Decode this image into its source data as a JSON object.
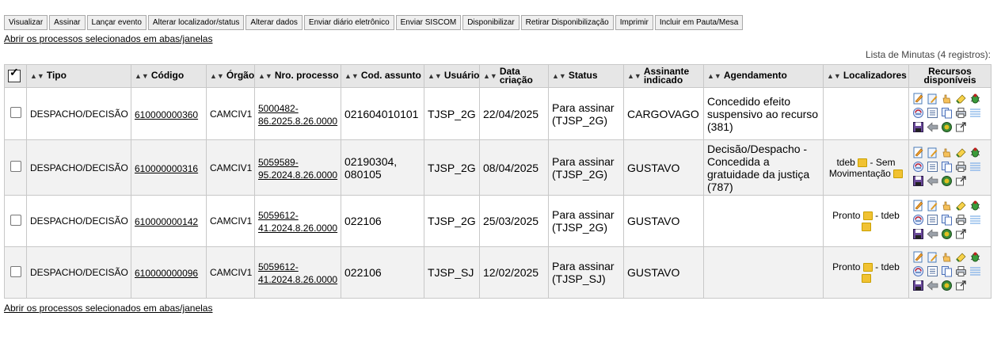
{
  "toolbar": {
    "buttons": [
      "Visualizar",
      "Assinar",
      "Lançar evento",
      "Alterar localizador/status",
      "Alterar dados",
      "Enviar diário eletrônico",
      "Enviar SISCOM",
      "Disponibilizar",
      "Retirar Disponibilização",
      "Imprimir",
      "Incluir em Pauta/Mesa"
    ]
  },
  "links": {
    "open_top": "Abrir os processos selecionados em abas/janelas",
    "open_bottom": "Abrir os processos selecionados em abas/janelas"
  },
  "list_count": "Lista de Minutas (4 registros):",
  "table": {
    "headers": {
      "tipo": "Tipo",
      "codigo": "Código",
      "orgao": "Órgão",
      "nro": "Nro. processo",
      "cod_assunto": "Cod. assunto",
      "usuario": "Usuário",
      "data1": "Data",
      "data2": "criação",
      "status": "Status",
      "assinante1": "Assinante",
      "assinante2": "indicado",
      "agendamento": "Agendamento",
      "localizadores": "Localizadores",
      "recursos1": "Recursos",
      "recursos2": "disponíveis"
    },
    "rows": [
      {
        "tipo": "DESPACHO/DECISÃO",
        "codigo": "610000000360",
        "orgao": "CAMCIV1",
        "nro1": "5000482-",
        "nro2": "86.2025.8.26.0000",
        "cod_assunto": "021604010101",
        "usuario": "TJSP_2G",
        "data": "22/04/2025",
        "status": "Para assinar (TJSP_2G)",
        "assinante": "CARGOVAGO",
        "agendamento": "Concedido efeito suspensivo ao recurso (381)",
        "loc1": "",
        "loc2": ""
      },
      {
        "tipo": "DESPACHO/DECISÃO",
        "codigo": "610000000316",
        "orgao": "CAMCIV1",
        "nro1": "5059589-",
        "nro2": "95.2024.8.26.0000",
        "cod_assunto": "02190304, 080105",
        "usuario": "TJSP_2G",
        "data": "08/04/2025",
        "status": "Para assinar (TJSP_2G)",
        "assinante": "GUSTAVO",
        "agendamento": "Decisão/Despacho - Concedida a gratuidade da justiça (787)",
        "loc1": "tdeb",
        "loc2": "- Sem Movimentação"
      },
      {
        "tipo": "DESPACHO/DECISÃO",
        "codigo": "610000000142",
        "orgao": "CAMCIV1",
        "nro1": "5059612-",
        "nro2": "41.2024.8.26.0000",
        "cod_assunto": "022106",
        "usuario": "TJSP_2G",
        "data": "25/03/2025",
        "status": "Para assinar (TJSP_2G)",
        "assinante": "GUSTAVO",
        "agendamento": "",
        "loc1": "Pronto",
        "loc2": "- tdeb"
      },
      {
        "tipo": "DESPACHO/DECISÃO",
        "codigo": "610000000096",
        "orgao": "CAMCIV1",
        "nro1": "5059612-",
        "nro2": "41.2024.8.26.0000",
        "cod_assunto": "022106",
        "usuario": "TJSP_SJ",
        "data": "12/02/2025",
        "status": "Para assinar (TJSP_SJ)",
        "assinante": "GUSTAVO",
        "agendamento": "",
        "loc1": "Pronto",
        "loc2": "- tdeb"
      }
    ],
    "resource_icons": [
      "edit-document-icon",
      "edit-pencil-icon",
      "hand-pointer-icon",
      "eraser-icon",
      "bug-icon",
      "compare-icon",
      "list-form-icon",
      "copy-icon",
      "printer-icon",
      "lines-icon",
      "save-disk-icon",
      "arrow-left-icon",
      "globe-icon",
      "export-icon"
    ]
  }
}
